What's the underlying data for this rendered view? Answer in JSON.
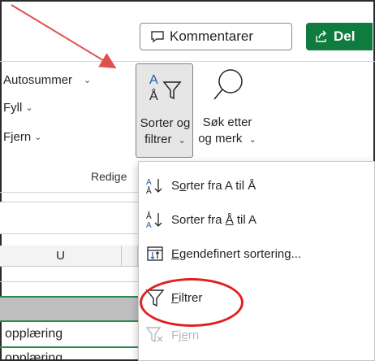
{
  "top_bar": {
    "comment_label": "Kommentarer",
    "share_label": "Del",
    "comment_icon": "comment-icon",
    "share_icon": "share-icon",
    "share_color": "#0f7b3e"
  },
  "editing_group": {
    "autosum_label": "Autosummer",
    "fill_label": "Fyll",
    "clear_label": "Fjern",
    "sort_filter": {
      "line1": "Sorter og",
      "line2": "filtrer",
      "icon": "sort-filter-icon"
    },
    "find_select": {
      "line1": "Søk etter",
      "line2": "og merk",
      "icon": "magnifier-icon"
    },
    "group_label": "Redige"
  },
  "sheet": {
    "column_header": "U",
    "cells": [
      "opplæring",
      "opplæring"
    ]
  },
  "menu": {
    "items": [
      {
        "label_pre": "S",
        "label_ul": "o",
        "label_post": "rter fra A til Å",
        "icon": "sort-a-to-z-icon",
        "disabled": false
      },
      {
        "label_pre": "Sorter fra ",
        "label_ul": "Å",
        "label_post": " til A",
        "icon": "sort-z-to-a-icon",
        "disabled": false
      },
      {
        "label_pre": "",
        "label_ul": "E",
        "label_post": "gendefinert sortering...",
        "icon": "custom-sort-icon",
        "disabled": false
      },
      {
        "label_pre": "",
        "label_ul": "F",
        "label_post": "iltrer",
        "icon": "filter-icon",
        "disabled": false
      },
      {
        "label_pre": "Fj",
        "label_ul": "e",
        "label_post": "rn",
        "icon": "clear-filter-icon",
        "disabled": true
      }
    ]
  },
  "annotations": {
    "arrow_color": "#e05050",
    "circle_color": "#e02020"
  }
}
